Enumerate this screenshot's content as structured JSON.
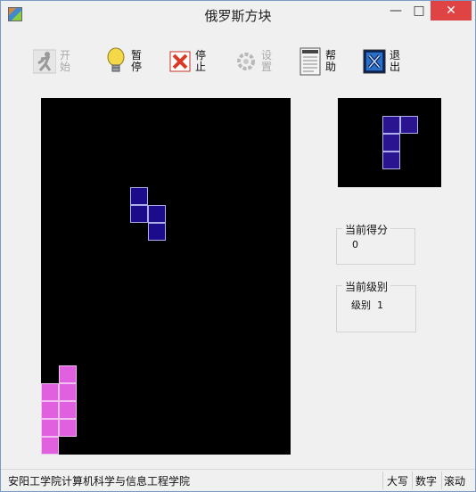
{
  "window": {
    "title": "俄罗斯方块"
  },
  "titlebar_buttons": {
    "minimize": "—",
    "maximize": "□",
    "close": "✕"
  },
  "toolbar": [
    {
      "label": "开始",
      "icon": "runner-icon",
      "enabled": false
    },
    {
      "label": "暂停",
      "icon": "lightbulb-icon",
      "enabled": true
    },
    {
      "label": "停止",
      "icon": "stop-x-icon",
      "enabled": true
    },
    {
      "label": "设置",
      "icon": "settings-gear-icon",
      "enabled": false
    },
    {
      "label": "帮助",
      "icon": "help-document-icon",
      "enabled": true
    },
    {
      "label": "退出",
      "icon": "exit-x-icon",
      "enabled": true
    }
  ],
  "score": {
    "legend": "当前得分",
    "value": "0"
  },
  "level": {
    "legend": "当前级别",
    "value": "级别  1"
  },
  "statusbar": {
    "text": "安阳工学院计算机科学与信息工程学院",
    "caps": "大写",
    "num": "数字",
    "scroll": "滚动"
  },
  "colors": {
    "active_piece": "#1c0c8c",
    "settled_piece": "#e060e0",
    "next_piece": "#2a1490",
    "board": "#000000"
  }
}
